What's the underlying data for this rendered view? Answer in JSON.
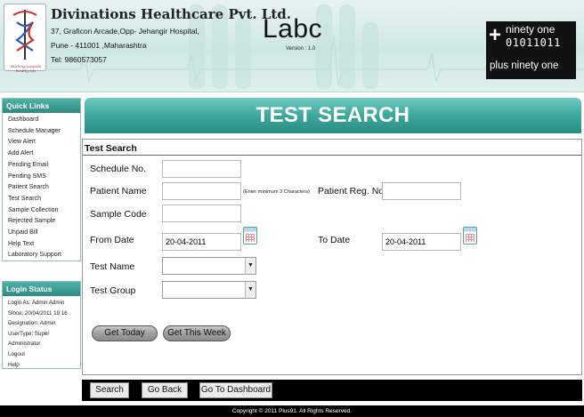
{
  "header": {
    "company_name": "Divinations Healthcare Pvt. Ltd.",
    "address_line1": "37, Graficon Arcade,Opp- Jehangir Hospital,",
    "address_line2": "Pune - 411001 ,Maharashtra",
    "phone": "Tel: 9860573057",
    "logo_tagline": "Working towards healthy life",
    "app_name": "Labc",
    "version": "Version : 1.0",
    "brand_top": "ninety one",
    "brand_binary": "01011011",
    "brand_plus": "+",
    "brand_bottom": "plus ninety one"
  },
  "sidebar": {
    "quick_links_title": "Quick Links",
    "quick_links": [
      "Dashboard",
      "Schedule Manager",
      "View Alert",
      "Add Alert",
      "Pending Email",
      "Pending SMS",
      "Patient Search",
      "Test Search",
      "Sample Collection",
      "Rejected Sample",
      "Unpaid Bill",
      "Help Text",
      "Laboratory Support"
    ],
    "login_status_title": "Login Status",
    "login_status": [
      "Login As: Admin Admin",
      "Since: 20/04/2011 19:16",
      "Designation: Admin",
      "UserType: Super",
      "Administrator",
      "Logout",
      "Help"
    ]
  },
  "main": {
    "title": "TEST SEARCH",
    "legend": "Test Search",
    "schedule_no_label": "Schedule No.",
    "schedule_no_value": "",
    "patient_name_label": "Patient Name",
    "patient_name_value": "",
    "patient_name_hint": "(Enter minimum 3 Characters)",
    "patient_reg_label": "Patient Reg. No",
    "patient_reg_value": "",
    "sample_code_label": "Sample Code",
    "sample_code_value": "",
    "from_date_label": "From Date",
    "from_date_value": "20-04-2011",
    "to_date_label": "To Date",
    "to_date_value": "20-04-2011",
    "test_name_label": "Test Name",
    "test_name_value": "",
    "test_group_label": "Test Group",
    "test_group_value": "",
    "get_today_label": "Get Today",
    "get_this_week_label": "Get This Week"
  },
  "actions": {
    "search_label": "Search",
    "go_back_label": "Go Back",
    "go_to_dashboard_label": "Go To Dashboard"
  },
  "footer": {
    "copyright": "Copyright © 2011 Plus91. All Rights Reserved."
  },
  "colors": {
    "accent_teal": "#3ea79b",
    "header_bg": "#d8ece9",
    "bar_black": "#000000"
  },
  "icons": {
    "calendar": "calendar-icon",
    "dropdown": "chevron-down-icon",
    "logo": "caduceus-logo"
  }
}
